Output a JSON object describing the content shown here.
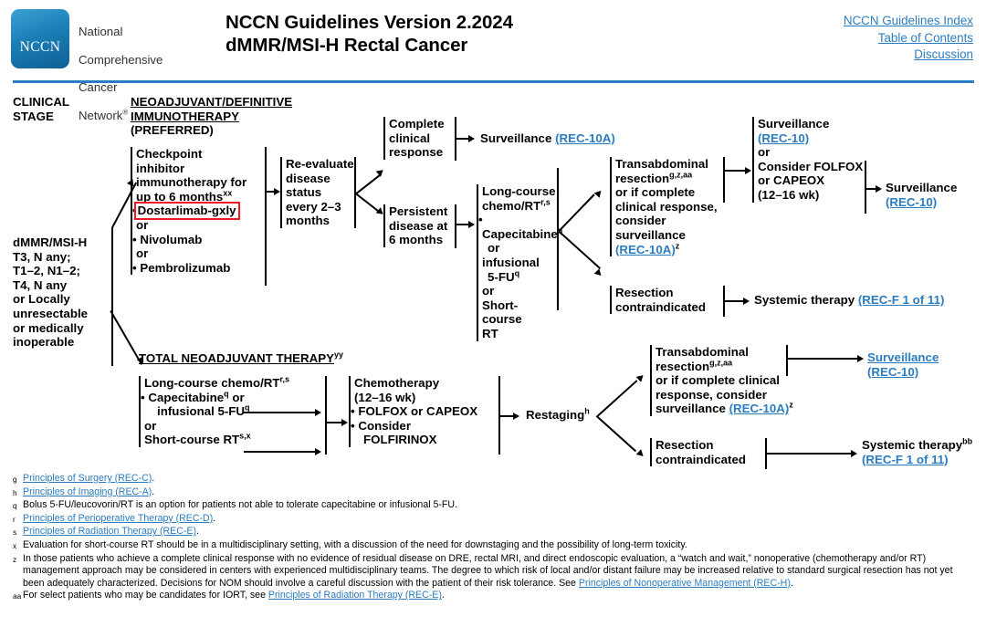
{
  "header": {
    "logo_text": "NCCN",
    "org_line1": "National",
    "org_line2": "Comprehensive",
    "org_line3": "Cancer",
    "org_line4": "Network",
    "org_mark": "®",
    "title_line1": "NCCN Guidelines Version 2.2024",
    "title_line2": "dMMR/MSI-H Rectal Cancer",
    "links": [
      "NCCN Guidelines Index",
      "Table of Contents",
      "Discussion"
    ]
  },
  "columns": {
    "clinical_stage": "CLINICAL\nSTAGE",
    "neoadjuvant_header_l1": "NEOADJUVANT/DEFINITIVE",
    "neoadjuvant_header_l2": "IMMUNOTHERAPY",
    "neoadjuvant_header_l3": "(PREFERRED)",
    "tnt_header": "TOTAL NEOADJUVANT THERAPY",
    "tnt_header_sup": "yy"
  },
  "nodes": {
    "stage": "dMMR/MSI-H\nT3, N any;\nT1–2, N1–2;\nT4, N any\nor Locally\nunresectable\nor medically\ninoperable",
    "checkpoint_l1": "Checkpoint",
    "checkpoint_l2": "inhibitor",
    "checkpoint_l3": "immunotherapy for",
    "checkpoint_l4": "up to 6 months",
    "checkpoint_sup": "xx",
    "drug1": "Dostarlimab-gxly",
    "or1": "or",
    "drug2": "Nivolumab",
    "or2": "or",
    "drug3": "Pembrolizumab",
    "reevaluate": "Re-evaluate\ndisease\nstatus\nevery 2–3\nmonths",
    "complete_response": "Complete\nclinical\nresponse",
    "persistent": "Persistent\ndisease at\n6 months",
    "surveillance_top_label": "Surveillance",
    "surveillance_top_link": "(REC-10A)",
    "longcourse_l1": "Long-course",
    "longcourse_l2": "chemo/RT",
    "longcourse_sup": "r,s",
    "longcourse_b1": "Capecitabine",
    "longcourse_b1_sup": "q",
    "longcourse_b2a": "or infusional",
    "longcourse_b2b": "5-FU",
    "longcourse_b2_sup": "q",
    "longcourse_or": "or",
    "longcourse_l3": "Short-course",
    "longcourse_l4": "RT",
    "transab_l1": "Transabdominal",
    "transab_l2": "resection",
    "transab_sup": "g,z,aa",
    "transab_l3": "or if complete",
    "transab_l4": "clinical response,",
    "transab_l5": "consider",
    "transab_l6": "surveillance",
    "transab_link": "(REC-10A)",
    "transab_link_sup": "z",
    "resection_contra": "Resection\ncontraindicated",
    "systemic_top_label": "Systemic therapy",
    "systemic_top_link": "(REC-F 1 of 11)",
    "surv_folfox_l1": "Surveillance",
    "surv_folfox_link": "(REC-10)",
    "surv_folfox_or": "or",
    "surv_folfox_l2": "Consider FOLFOX",
    "surv_folfox_l3": "or CAPEOX",
    "surv_folfox_l4": "(12–16 wk)",
    "surv_final_label": "Surveillance",
    "surv_final_link": "(REC-10)",
    "tnt_lc_l1": "Long-course chemo/RT",
    "tnt_lc_sup": "r,s",
    "tnt_lc_b1": "Capecitabine",
    "tnt_lc_b1_sup": "q",
    "tnt_lc_b1_tail": " or",
    "tnt_lc_b2": "infusional 5-FU",
    "tnt_lc_b2_sup": "q",
    "tnt_lc_or": "or",
    "tnt_lc_l2": "Short-course RT",
    "tnt_lc_l2_sup": "s,x",
    "chemo_l1": "Chemotherapy",
    "chemo_l2": "(12–16 wk)",
    "chemo_b1": "FOLFOX or CAPEOX",
    "chemo_b2a": "Consider",
    "chemo_b2b": "FOLFIRINOX",
    "restaging": "Restaging",
    "restaging_sup": "h",
    "tnt_transab_l1": "Transabdominal",
    "tnt_transab_l2": "resection",
    "tnt_transab_sup": "g,z,aa",
    "tnt_transab_l3": "or if complete clinical",
    "tnt_transab_l4": "response, consider",
    "tnt_transab_l5": "surveillance",
    "tnt_transab_link": "(REC-10A)",
    "tnt_transab_link_sup": "z",
    "tnt_surv_l1": "Surveillance",
    "tnt_surv_link": "(REC-10)",
    "tnt_resection_contra": "Resection\ncontraindicated",
    "tnt_systemic_label": "Systemic therapy",
    "tnt_systemic_sup": "bb",
    "tnt_systemic_link": "(REC-F 1 of 11)"
  },
  "footnotes": [
    {
      "mark": "g",
      "parts": [
        {
          "t": "Principles of Surgery (REC-C)",
          "link": true
        },
        {
          "t": ".",
          "link": false
        }
      ]
    },
    {
      "mark": "h",
      "parts": [
        {
          "t": "Principles of Imaging (REC-A)",
          "link": true
        },
        {
          "t": ".",
          "link": false
        }
      ]
    },
    {
      "mark": "q",
      "parts": [
        {
          "t": "Bolus 5-FU/leucovorin/RT is an option for patients not able to tolerate capecitabine or infusional 5-FU.",
          "link": false
        }
      ]
    },
    {
      "mark": "r",
      "parts": [
        {
          "t": "Principles of Perioperative Therapy (REC-D)",
          "link": true
        },
        {
          "t": ".",
          "link": false
        }
      ]
    },
    {
      "mark": "s",
      "parts": [
        {
          "t": "Principles of Radiation Therapy (REC-E)",
          "link": true
        },
        {
          "t": ".",
          "link": false
        }
      ]
    },
    {
      "mark": "x",
      "parts": [
        {
          "t": "Evaluation for short-course RT should be in a multidisciplinary setting, with a discussion of the need for downstaging and the possibility of long-term toxicity.",
          "link": false
        }
      ]
    },
    {
      "mark": "z",
      "parts": [
        {
          "t": "In those patients who achieve a complete clinical response with no evidence of residual disease on DRE, rectal MRI, and direct endoscopic evaluation, a “watch and wait,” nonoperative (chemotherapy and/or RT) management approach may be considered in centers with experienced multidisciplinary teams. The degree to which risk of local and/or distant failure may be increased relative to standard surgical resection has not yet been adequately characterized. Decisions for NOM should involve a careful discussion with the patient of their risk tolerance. See ",
          "link": false
        },
        {
          "t": "Principles of Nonoperative Management (REC-H)",
          "link": true
        },
        {
          "t": ".",
          "link": false
        }
      ]
    },
    {
      "mark": "aa",
      "parts": [
        {
          "t": "For select patients who may be candidates for IORT, see ",
          "link": false
        },
        {
          "t": "Principles of Radiation Therapy (REC-E)",
          "link": true
        },
        {
          "t": ".",
          "link": false
        }
      ]
    }
  ]
}
